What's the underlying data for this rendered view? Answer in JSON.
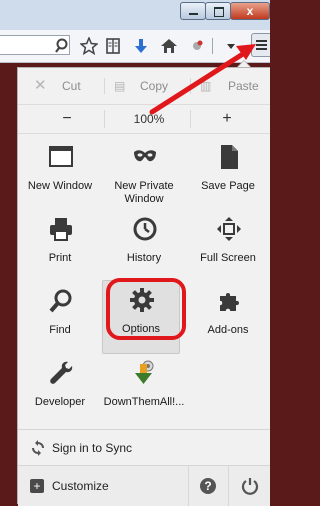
{
  "window": {
    "close_label": "x"
  },
  "toolbar": {
    "icons": [
      "search-icon",
      "bookmark-star-icon",
      "reading-list-icon",
      "download-icon",
      "home-icon",
      "addons-icon",
      "dropdown-icon",
      "hamburger-menu-icon"
    ]
  },
  "edit": {
    "cut": "Cut",
    "copy": "Copy",
    "paste": "Paste"
  },
  "zoom": {
    "minus": "−",
    "level": "100%",
    "plus": "+"
  },
  "tiles": [
    {
      "label": "New Window",
      "icon": "new-window-icon"
    },
    {
      "label": "New Private Window",
      "icon": "private-mask-icon"
    },
    {
      "label": "Save Page",
      "icon": "save-page-icon"
    },
    {
      "label": "Print",
      "icon": "printer-icon"
    },
    {
      "label": "History",
      "icon": "clock-icon"
    },
    {
      "label": "Full Screen",
      "icon": "fullscreen-icon"
    },
    {
      "label": "Find",
      "icon": "magnifier-icon"
    },
    {
      "label": "Options",
      "icon": "gear-icon"
    },
    {
      "label": "Add-ons",
      "icon": "puzzle-icon"
    },
    {
      "label": "Developer",
      "icon": "wrench-icon"
    },
    {
      "label": "DownThemAll!...",
      "icon": "downthemall-icon"
    }
  ],
  "footer": {
    "sync": "Sign in to Sync",
    "customize": "Customize"
  },
  "colors": {
    "highlight": "#e0171b",
    "background": "#5a1a1a"
  }
}
